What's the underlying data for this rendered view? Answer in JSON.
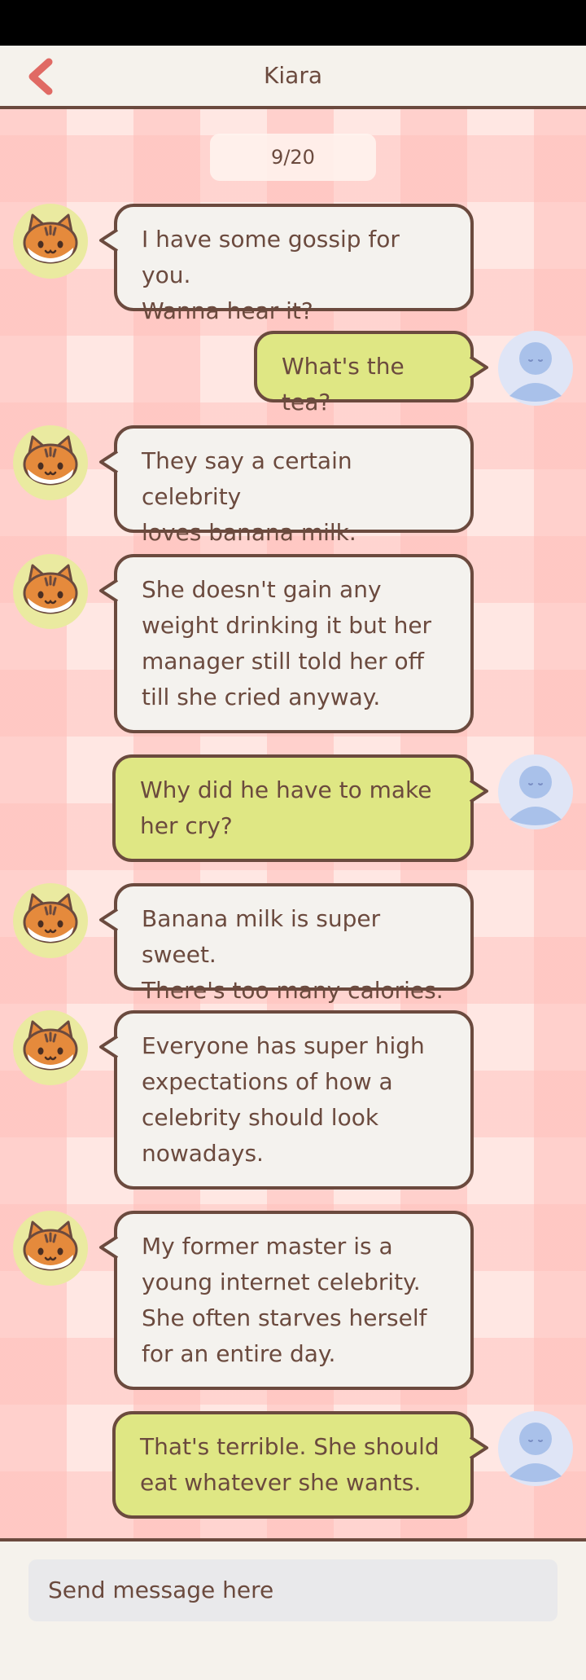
{
  "header": {
    "title": "Kiara",
    "back_icon": "chevron-left-icon"
  },
  "counter": "9/20",
  "messages": [
    {
      "from": "npc",
      "text": "I have some gossip for you.\nWanna hear it?"
    },
    {
      "from": "me",
      "text": "What's the tea?"
    },
    {
      "from": "npc",
      "text": "They say a certain celebrity\nloves banana milk."
    },
    {
      "from": "npc",
      "text": "She doesn't gain any\nweight drinking it but her\nmanager still told her off\ntill she cried anyway."
    },
    {
      "from": "me",
      "text": "Why did he have to make\nher cry?"
    },
    {
      "from": "npc",
      "text": "Banana milk is super sweet.\nThere's too many calories."
    },
    {
      "from": "npc",
      "text": "Everyone has super high\nexpectations of how a\ncelebrity should look\nnowadays."
    },
    {
      "from": "npc",
      "text": "My former master is a\nyoung internet celebrity.\nShe often starves herself\nfor an entire day."
    },
    {
      "from": "me",
      "text": "That's terrible. She should\neat whatever she wants."
    }
  ],
  "input": {
    "placeholder": "Send message here"
  },
  "colors": {
    "accent": "#e06a64",
    "text": "#6b4a3e",
    "npc_bubble": "#f4f2ee",
    "my_bubble": "#dfe784",
    "chat_bg": "#ffe7e3"
  },
  "icons": {
    "npc_avatar": "cat-face-icon",
    "user_avatar": "user-silhouette-icon"
  }
}
